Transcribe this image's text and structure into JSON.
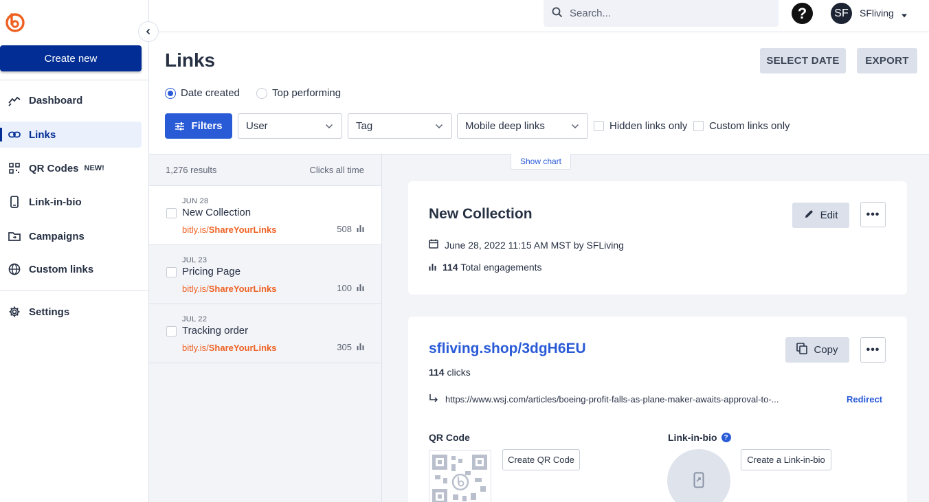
{
  "sidebar": {
    "create_label": "Create new",
    "items": [
      {
        "label": "Dashboard",
        "icon": "trend-icon"
      },
      {
        "label": "Links",
        "icon": "link-icon"
      },
      {
        "label": "QR Codes",
        "icon": "qr-icon",
        "badge": "NEW!"
      },
      {
        "label": "Link-in-bio",
        "icon": "phone-icon"
      },
      {
        "label": "Campaigns",
        "icon": "folder-icon"
      },
      {
        "label": "Custom links",
        "icon": "globe-icon"
      },
      {
        "label": "Settings",
        "icon": "gear-icon"
      }
    ]
  },
  "topbar": {
    "search_placeholder": "Search...",
    "help": "?",
    "avatar_initials": "SF",
    "username": "SFliving"
  },
  "header": {
    "title": "Links",
    "select_date": "SELECT DATE",
    "export": "EXPORT",
    "sort_options": [
      "Date created",
      "Top performing"
    ],
    "sort_selected": "Date created"
  },
  "filters": {
    "button": "Filters",
    "user": "User",
    "tag": "Tag",
    "mobile": "Mobile deep links",
    "hidden_only": "Hidden links only",
    "custom_only": "Custom links only"
  },
  "list": {
    "results": "1,276 results",
    "clicks_header": "Clicks all time",
    "items": [
      {
        "date": "JUN 28",
        "title": "New Collection",
        "domain": "bitly.is/",
        "backhalf": "ShareYourLinks",
        "clicks": "508"
      },
      {
        "date": "JUL 23",
        "title": "Pricing Page",
        "domain": "bitly.is/",
        "backhalf": "ShareYourLinks",
        "clicks": "100"
      },
      {
        "date": "JUL 22",
        "title": "Tracking order",
        "domain": "bitly.is/",
        "backhalf": "ShareYourLinks",
        "clicks": "305"
      }
    ]
  },
  "detail": {
    "show_chart": "Show chart",
    "title": "New Collection",
    "edit": "Edit",
    "more": "•••",
    "created": "June 28, 2022 11:15 AM MST by SFLiving",
    "engagements_count": "114",
    "engagements_label": "Total engagements",
    "short_link": "sfliving.shop/3dgH6EU",
    "copy": "Copy",
    "clicks_count": "114",
    "clicks_label": "clicks",
    "destination": "https://www.wsj.com/articles/boeing-profit-falls-as-plane-maker-awaits-approval-to-...",
    "redirect": "Redirect",
    "qr_label": "QR Code",
    "create_qr": "Create QR Code",
    "lib_label": "Link-in-bio",
    "lib_help": "?",
    "create_lib": "Create a Link-in-bio"
  },
  "colors": {
    "primary": "#022d94",
    "accent": "#2a5bd7",
    "orange": "#ee6123"
  }
}
